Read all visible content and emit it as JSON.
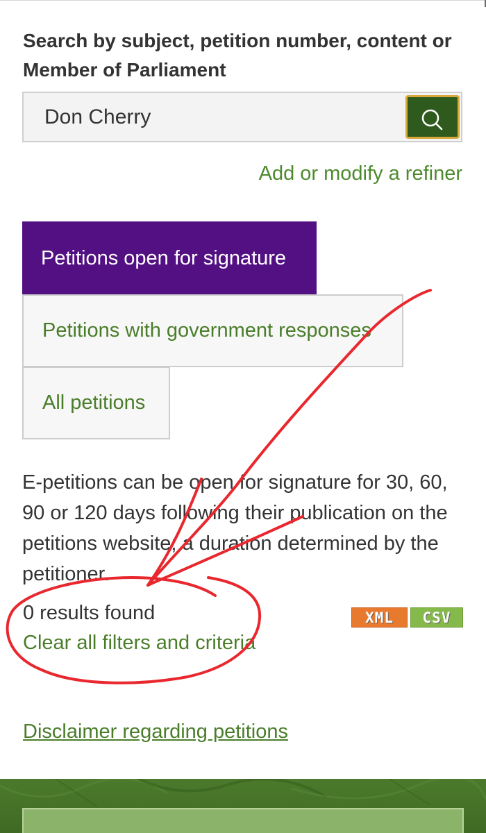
{
  "search": {
    "label": "Search by subject, petition number, content or Member of Parliament",
    "value": "Don Cherry",
    "button_icon": "search-icon",
    "refiner_link": "Add or modify a refiner"
  },
  "tabs": [
    {
      "label": "Petitions open for signature",
      "active": true
    },
    {
      "label": "Petitions with government responses",
      "active": false
    },
    {
      "label": "All petitions",
      "active": false
    }
  ],
  "info": {
    "text": "E-petitions can be open for signature for 30, 60, 90 or 120 days following their publication on the petitions website; a duration determined by the petitioner."
  },
  "results": {
    "count_text": "0 results found",
    "clear_link": "Clear all filters and criteria",
    "export_xml": "XML",
    "export_csv": "CSV"
  },
  "disclaimer": {
    "link": "Disclaimer regarding petitions"
  },
  "colors": {
    "active_tab": "#521083",
    "link_green": "#4a7d2a",
    "search_button": "#2f5a1e",
    "search_button_border": "#d9a93a",
    "xml_badge": "#e87a2f",
    "csv_badge": "#86b94c",
    "annotation_red": "#e8282e",
    "footer_green": "#466f28"
  }
}
